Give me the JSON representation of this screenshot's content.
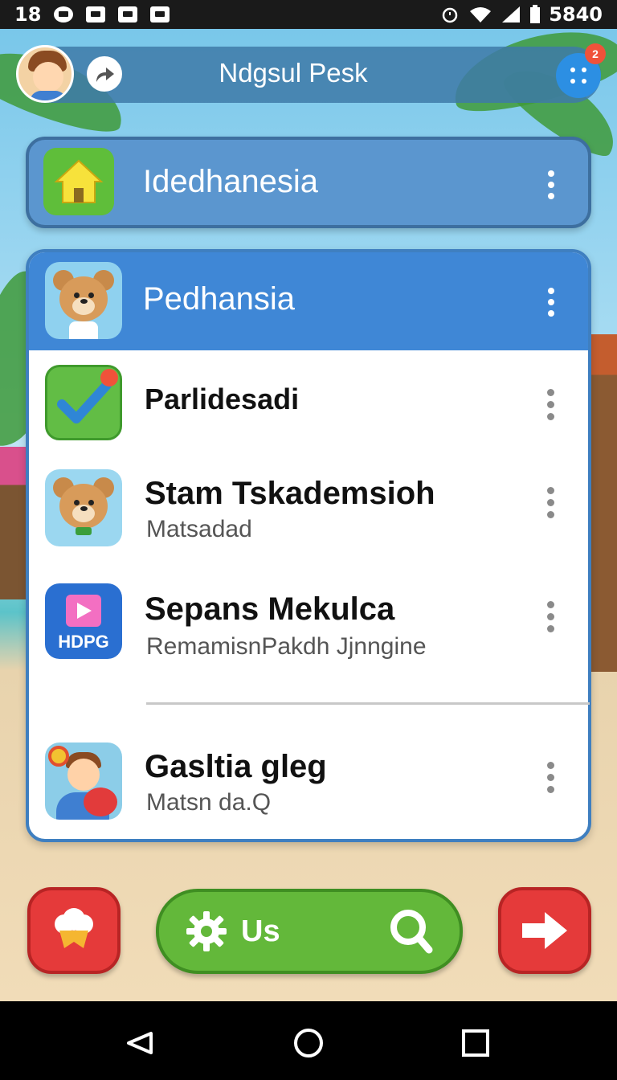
{
  "status_bar": {
    "time": "18",
    "battery_value": "5840"
  },
  "header": {
    "title": "Ndgsul Pesk",
    "notification_badge": "2"
  },
  "home_card": {
    "title": "Idedhanesia"
  },
  "panel": {
    "title": "Pedhansia",
    "items": [
      {
        "title": "Parlidesadi",
        "subtitle": "",
        "icon": "checkmark-icon"
      },
      {
        "title": "Stam Tskademsioh",
        "subtitle": "Matsadad",
        "icon": "bear-icon"
      },
      {
        "title": "Sepans Mekulca",
        "subtitle": "RemamisnPakdh Jjnngine",
        "icon": "gift-video-icon",
        "icon_text": "HDPG"
      },
      {
        "title": "Gasltia gleg",
        "subtitle": "Matsn da.Q",
        "icon": "boy-icon"
      }
    ]
  },
  "bottom_bar": {
    "pill_label": "Us"
  },
  "colors": {
    "header_blue": "#3e7aa8",
    "panel_blue": "#3f87d6",
    "green": "#63b83a",
    "red": "#e53a3a"
  }
}
